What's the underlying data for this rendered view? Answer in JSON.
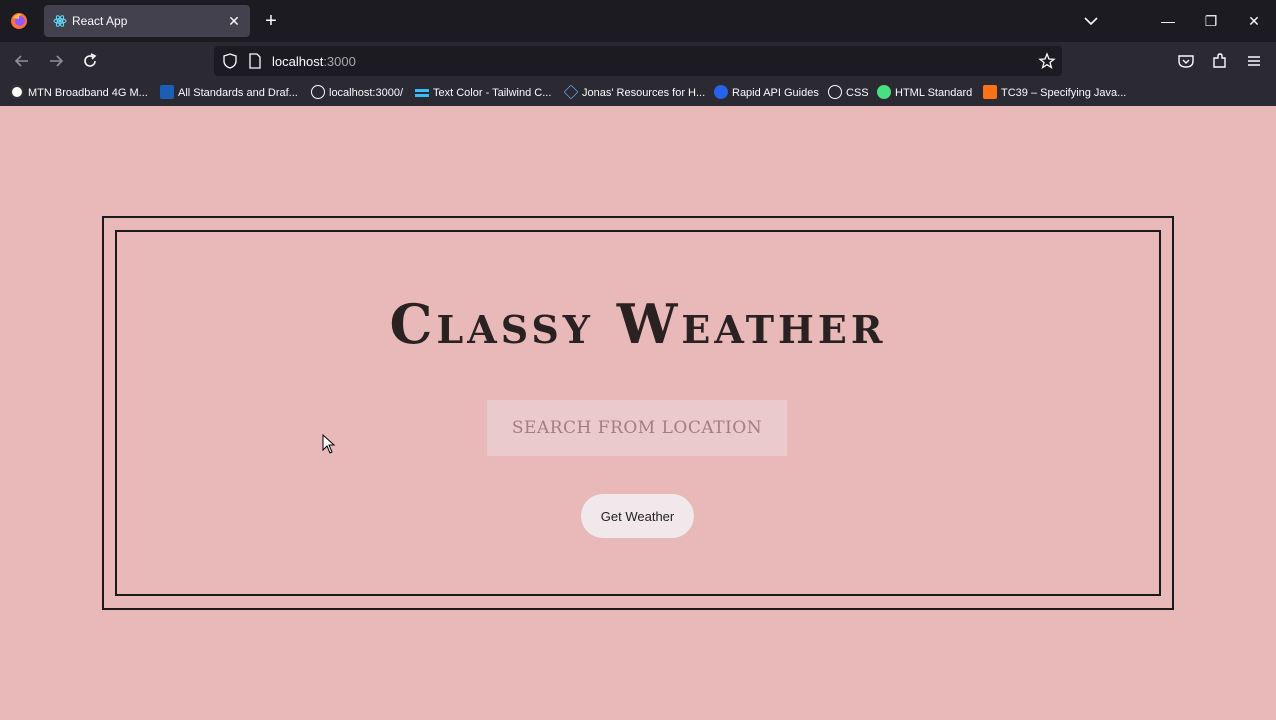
{
  "browser": {
    "tab_title": "React App",
    "tab_close": "✕",
    "new_tab": "+",
    "url_host": "localhost",
    "url_port": ":3000",
    "window": {
      "minimize": "—",
      "restore": "❐",
      "close": "✕"
    },
    "bookmarks": [
      {
        "label": "MTN Broadband 4G M...",
        "icon": "mtn-icon",
        "color": "#ffffff"
      },
      {
        "label": "All Standards and Draf...",
        "icon": "w3c-icon",
        "color": "#1a5fb4"
      },
      {
        "label": "localhost:3000/",
        "icon": "globe-icon",
        "color": "#fbfbfe"
      },
      {
        "label": "Text Color - Tailwind C...",
        "icon": "tailwind-icon",
        "color": "#38bdf8"
      },
      {
        "label": "Jonas' Resources for H...",
        "icon": "diamond-icon",
        "color": "#60a5fa"
      },
      {
        "label": "Rapid API Guides",
        "icon": "rapid-api-icon",
        "color": "#2563eb"
      },
      {
        "label": "CSS",
        "icon": "globe-icon",
        "color": "#fbfbfe"
      },
      {
        "label": "HTML Standard",
        "icon": "html-standard-icon",
        "color": "#4ade80"
      },
      {
        "label": "TC39 – Specifying Java...",
        "icon": "tc39-icon",
        "color": "#f97316"
      }
    ]
  },
  "app": {
    "title": "Classy Weather",
    "search_placeholder": "Search from location",
    "search_value": "",
    "button_label": "Get Weather"
  },
  "colors": {
    "page_bg": "#e8b9b8",
    "frame": "#1a1a1a",
    "input_bg": "#eacaca",
    "button_bg": "#f0e8ea"
  }
}
